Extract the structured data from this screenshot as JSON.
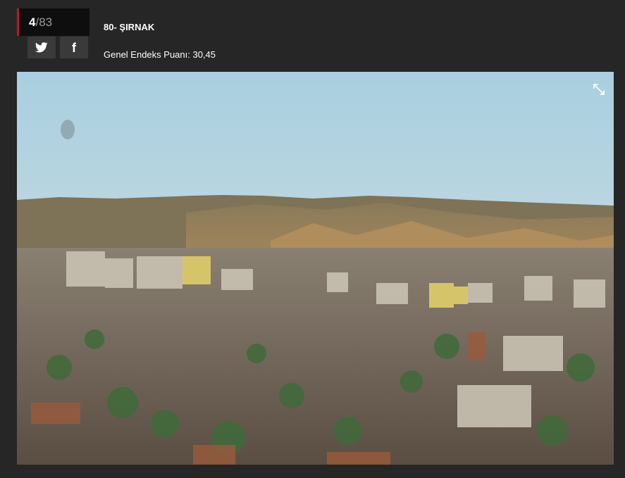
{
  "slide": {
    "current": "4",
    "total": "/83"
  },
  "share": {
    "twitter_icon": "twitter-icon",
    "facebook_icon": "facebook-icon",
    "facebook_glyph": "f"
  },
  "heading": {
    "title": "80- ŞIRNAK",
    "index_text": "Genel Endeks Puanı: 30,45"
  },
  "photo": {
    "expand_icon": "expand-icon"
  },
  "colors": {
    "background": "#262626",
    "counter_bg": "#0e0e0e",
    "accent": "#c8102e",
    "button_bg": "#3a3a3a"
  }
}
